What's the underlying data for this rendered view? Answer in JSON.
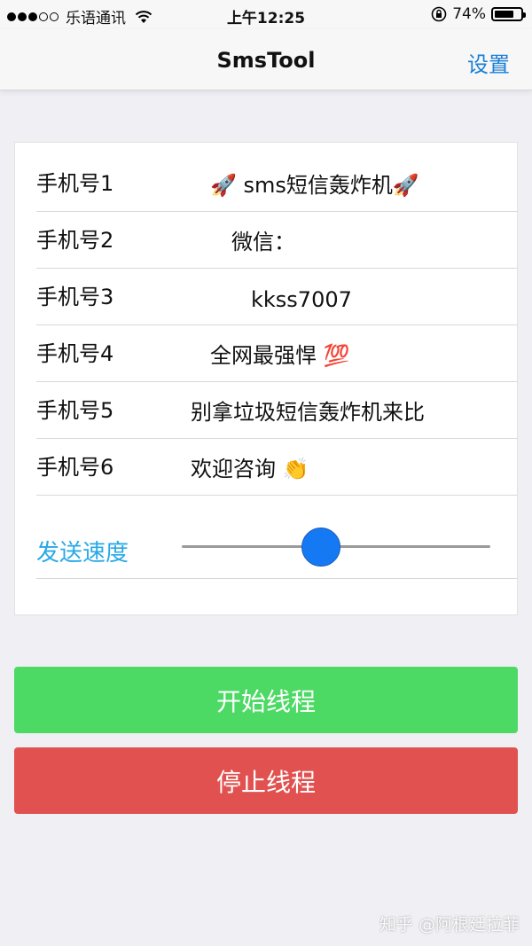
{
  "status_bar": {
    "carrier": "乐语通讯",
    "signal_strength": 3,
    "signal_max": 5,
    "time": "上午12:25",
    "battery": "74%",
    "battery_level": 0.74
  },
  "nav": {
    "title": "SmsTool",
    "settings_label": "设置"
  },
  "form": {
    "rows": [
      {
        "label": "手机号1",
        "value": "🚀 sms短信轰炸机🚀"
      },
      {
        "label": "手机号2",
        "value": "微信："
      },
      {
        "label": "手机号3",
        "value": "kkss7007"
      },
      {
        "label": "手机号4",
        "value": "全网最强悍 💯"
      },
      {
        "label": "手机号5",
        "value": "别拿垃圾短信轰炸机来比"
      },
      {
        "label": "手机号6",
        "value": "欢迎咨询 👏"
      }
    ],
    "speed_label": "发送速度",
    "speed_value": 0.45
  },
  "buttons": {
    "start_label": "开始线程",
    "stop_label": "停止线程"
  },
  "watermark": "知乎 @阿根廷拉菲",
  "colors": {
    "accent_blue": "#1a7fd6",
    "speed_label": "#29a9e6",
    "slider_thumb": "#1679f4",
    "start_button": "#4cd964",
    "stop_button": "#e0514f",
    "background": "#efeff4"
  }
}
